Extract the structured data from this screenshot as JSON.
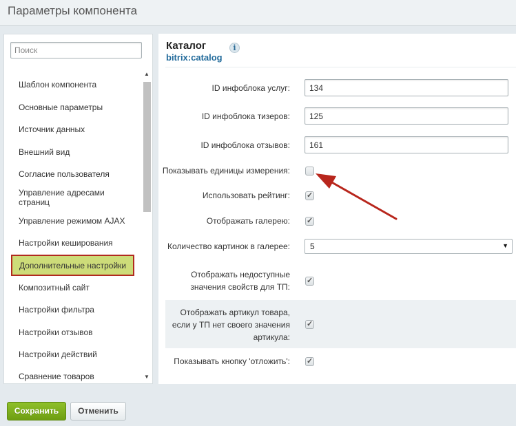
{
  "header": {
    "title": "Параметры компонента"
  },
  "sidebar": {
    "search_placeholder": "Поиск",
    "items": [
      {
        "label": "Шаблон компонента"
      },
      {
        "label": "Основные параметры"
      },
      {
        "label": "Источник данных"
      },
      {
        "label": "Внешний вид"
      },
      {
        "label": "Согласие пользователя"
      },
      {
        "label": "Управление адресами страниц"
      },
      {
        "label": "Управление режимом AJAX"
      },
      {
        "label": "Настройки кеширования"
      },
      {
        "label": "Дополнительные настройки",
        "active": true
      },
      {
        "label": "Композитный сайт"
      },
      {
        "label": "Настройки фильтра"
      },
      {
        "label": "Настройки отзывов"
      },
      {
        "label": "Настройки действий"
      },
      {
        "label": "Сравнение товаров"
      }
    ],
    "scroll_up_icon": "triangle-up-icon",
    "scroll_down_icon": "triangle-down-icon"
  },
  "component": {
    "title": "Каталог",
    "code": "bitrix:catalog",
    "info_icon": "info-icon"
  },
  "fields": {
    "services_iblock": {
      "label": "ID инфоблока услуг:",
      "value": "134"
    },
    "teasers_iblock": {
      "label": "ID инфоблока тизеров:",
      "value": "125"
    },
    "reviews_iblock": {
      "label": "ID инфоблока отзывов:",
      "value": "161"
    },
    "show_units": {
      "label": "Показывать единицы измерения:",
      "checked": false
    },
    "use_rating": {
      "label": "Использовать рейтинг:",
      "checked": true
    },
    "show_gallery": {
      "label": "Отображать галерею:",
      "checked": true
    },
    "gallery_count": {
      "label": "Количество картинок в галерее:",
      "value": "5"
    },
    "show_unavailable": {
      "label_line1": "Отображать недоступные",
      "label_line2": "значения свойств для ТП:",
      "checked": true
    },
    "show_article": {
      "label_line1": "Отображать артикул товара,",
      "label_line2": "если у ТП нет своего значения",
      "label_line3": "артикула:",
      "checked": true
    },
    "show_defer_button": {
      "label": "Показывать кнопку 'отложить':",
      "checked": true
    }
  },
  "check_glyph": "✓",
  "footer": {
    "save_label": "Сохранить",
    "cancel_label": "Отменить"
  },
  "colors": {
    "active_item_bg": "#cddc79",
    "active_item_border": "#b12a1f",
    "annotation_arrow": "#b8261c",
    "save_button": "#7aad1b",
    "component_code": "#246c9c"
  }
}
